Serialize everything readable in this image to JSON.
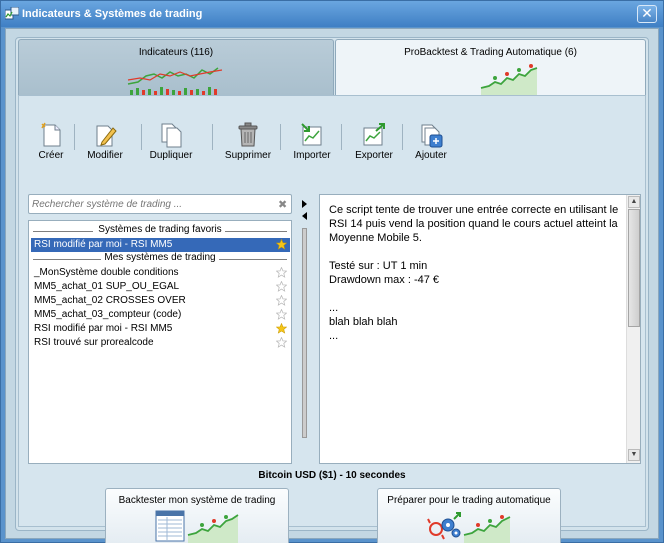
{
  "window": {
    "title": "Indicateurs & Systèmes de trading",
    "close_glyph": "✕",
    "app_icon": "chart-windows-icon"
  },
  "tabs": [
    {
      "label": "Indicateurs (116)",
      "active": false
    },
    {
      "label": "ProBacktest & Trading Automatique (6)",
      "active": true
    }
  ],
  "toolbar": {
    "items": [
      {
        "label": "Créer",
        "icon": "new-document-icon"
      },
      {
        "label": "Modifier",
        "icon": "edit-pencil-icon"
      },
      {
        "label": "Dupliquer",
        "icon": "duplicate-icon"
      },
      {
        "label": "Supprimer",
        "icon": "trash-can-icon"
      },
      {
        "label": "Importer",
        "icon": "import-icon"
      },
      {
        "label": "Exporter",
        "icon": "export-icon"
      },
      {
        "label": "Ajouter",
        "icon": "add-icon"
      }
    ]
  },
  "search": {
    "placeholder": "Rechercher système de trading ...",
    "clear_glyph": "✖"
  },
  "list": {
    "favorites_header": "Systèmes de trading favoris",
    "favorites": [
      {
        "label": "RSI modifié par moi - RSI MM5",
        "selected": true,
        "favorite": true
      }
    ],
    "my_systems_header": "Mes systèmes de trading",
    "my_systems": [
      {
        "label": "_MonSystème double conditions",
        "favorite": false
      },
      {
        "label": "MM5_achat_01 SUP_OU_EGAL",
        "favorite": false
      },
      {
        "label": "MM5_achat_02 CROSSES OVER",
        "favorite": false
      },
      {
        "label": "MM5_achat_03_compteur (code)",
        "favorite": false
      },
      {
        "label": "RSI modifié par moi - RSI MM5",
        "favorite": true
      },
      {
        "label": "RSI trouvé sur prorealcode",
        "favorite": false
      }
    ]
  },
  "description": {
    "text": "Ce script tente de trouver une entrée correcte en utilisant le RSI 14 puis vend la position quand le cours actuel atteint la Moyenne Mobile 5.\n\nTesté sur : UT 1 min\nDrawdown max : -47 €\n\n...\nblah blah blah\n..."
  },
  "status": {
    "instrument": "Bitcoin USD ($1) - 10 secondes"
  },
  "buttons": {
    "backtest_label": "Backtester mon système de trading",
    "automatic_label": "Préparer pour le trading automatique"
  },
  "colors": {
    "selection": "#3569b8",
    "chart_green": "#3da43d",
    "chart_red": "#e03a2a",
    "title_blue": "#3f7fc4"
  }
}
